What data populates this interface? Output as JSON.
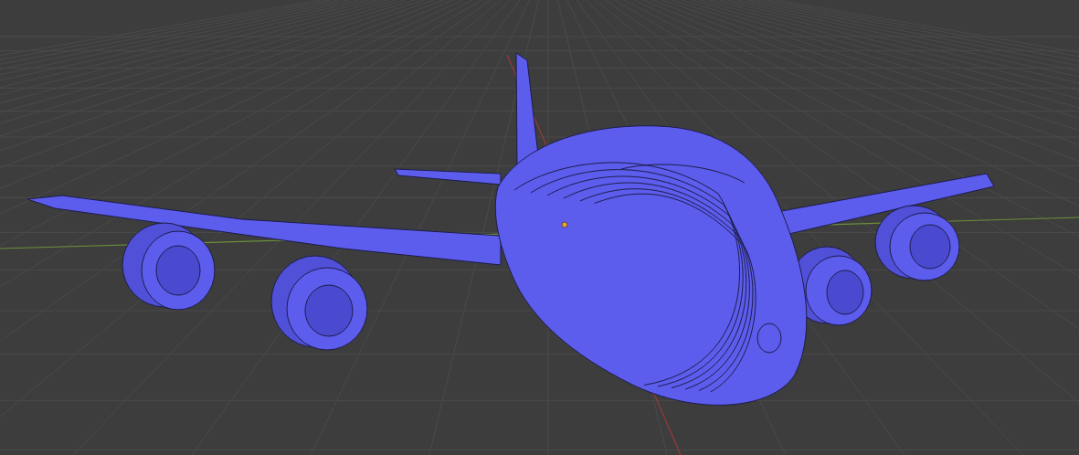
{
  "viewport": {
    "grid": true,
    "object_origin": true
  }
}
